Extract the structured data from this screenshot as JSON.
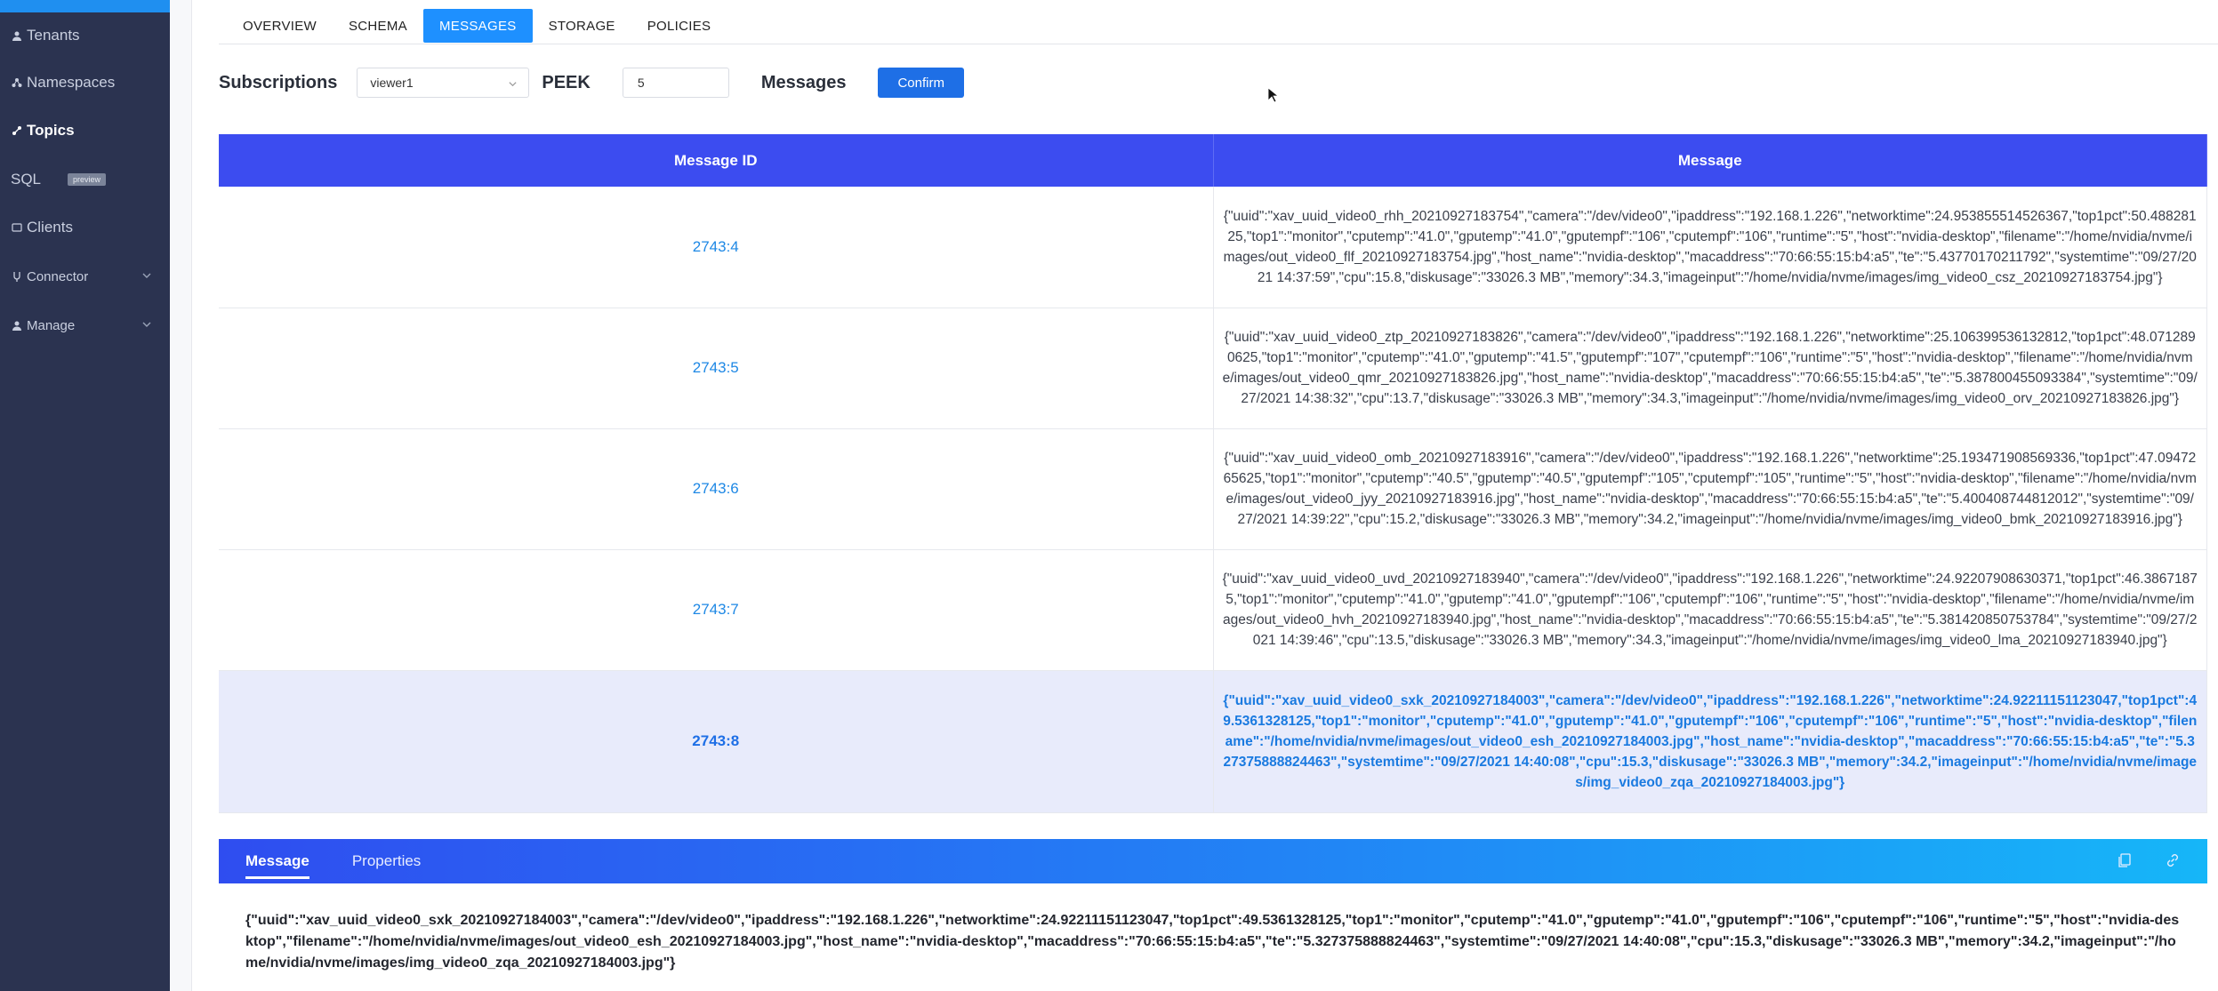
{
  "sidebar": {
    "items": [
      {
        "label": "Tenants",
        "icon": "user-icon"
      },
      {
        "label": "Namespaces",
        "icon": "namespace-icon"
      },
      {
        "label": "Topics",
        "icon": "topic-icon"
      },
      {
        "label": "SQL",
        "badge": "preview"
      },
      {
        "label": "Clients",
        "icon": "clients-icon"
      },
      {
        "label": "Connector",
        "icon": "connector-icon"
      },
      {
        "label": "Manage",
        "icon": "manage-icon"
      }
    ]
  },
  "tabs": [
    "OVERVIEW",
    "SCHEMA",
    "MESSAGES",
    "STORAGE",
    "POLICIES"
  ],
  "toolbar": {
    "subscriptions_label": "Subscriptions",
    "subscription_value": "viewer1",
    "peek_label": "PEEK",
    "peek_value": "5",
    "messages_label": "Messages",
    "confirm_label": "Confirm"
  },
  "table": {
    "headers": [
      "Message ID",
      "Message"
    ],
    "rows": [
      {
        "id": "2743:4",
        "message": "{\"uuid\":\"xav_uuid_video0_rhh_20210927183754\",\"camera\":\"/dev/video0\",\"ipaddress\":\"192.168.1.226\",\"networktime\":24.953855514526367,\"top1pct\":50.48828125,\"top1\":\"monitor\",\"cputemp\":\"41.0\",\"gputemp\":\"41.0\",\"gputempf\":\"106\",\"cputempf\":\"106\",\"runtime\":\"5\",\"host\":\"nvidia-desktop\",\"filename\":\"/home/nvidia/nvme/images/out_video0_flf_20210927183754.jpg\",\"host_name\":\"nvidia-desktop\",\"macaddress\":\"70:66:55:15:b4:a5\",\"te\":\"5.43770170211792\",\"systemtime\":\"09/27/2021 14:37:59\",\"cpu\":15.8,\"diskusage\":\"33026.3 MB\",\"memory\":34.3,\"imageinput\":\"/home/nvidia/nvme/images/img_video0_csz_20210927183754.jpg\"}"
      },
      {
        "id": "2743:5",
        "message": "{\"uuid\":\"xav_uuid_video0_ztp_20210927183826\",\"camera\":\"/dev/video0\",\"ipaddress\":\"192.168.1.226\",\"networktime\":25.106399536132812,\"top1pct\":48.0712890625,\"top1\":\"monitor\",\"cputemp\":\"41.0\",\"gputemp\":\"41.5\",\"gputempf\":\"107\",\"cputempf\":\"106\",\"runtime\":\"5\",\"host\":\"nvidia-desktop\",\"filename\":\"/home/nvidia/nvme/images/out_video0_qmr_20210927183826.jpg\",\"host_name\":\"nvidia-desktop\",\"macaddress\":\"70:66:55:15:b4:a5\",\"te\":\"5.387800455093384\",\"systemtime\":\"09/27/2021 14:38:32\",\"cpu\":13.7,\"diskusage\":\"33026.3 MB\",\"memory\":34.3,\"imageinput\":\"/home/nvidia/nvme/images/img_video0_orv_20210927183826.jpg\"}"
      },
      {
        "id": "2743:6",
        "message": "{\"uuid\":\"xav_uuid_video0_omb_20210927183916\",\"camera\":\"/dev/video0\",\"ipaddress\":\"192.168.1.226\",\"networktime\":25.193471908569336,\"top1pct\":47.0947265625,\"top1\":\"monitor\",\"cputemp\":\"40.5\",\"gputemp\":\"40.5\",\"gputempf\":\"105\",\"cputempf\":\"105\",\"runtime\":\"5\",\"host\":\"nvidia-desktop\",\"filename\":\"/home/nvidia/nvme/images/out_video0_jyy_20210927183916.jpg\",\"host_name\":\"nvidia-desktop\",\"macaddress\":\"70:66:55:15:b4:a5\",\"te\":\"5.400408744812012\",\"systemtime\":\"09/27/2021 14:39:22\",\"cpu\":15.2,\"diskusage\":\"33026.3 MB\",\"memory\":34.2,\"imageinput\":\"/home/nvidia/nvme/images/img_video0_bmk_20210927183916.jpg\"}"
      },
      {
        "id": "2743:7",
        "message": "{\"uuid\":\"xav_uuid_video0_uvd_20210927183940\",\"camera\":\"/dev/video0\",\"ipaddress\":\"192.168.1.226\",\"networktime\":24.92207908630371,\"top1pct\":46.38671875,\"top1\":\"monitor\",\"cputemp\":\"41.0\",\"gputemp\":\"41.0\",\"gputempf\":\"106\",\"cputempf\":\"106\",\"runtime\":\"5\",\"host\":\"nvidia-desktop\",\"filename\":\"/home/nvidia/nvme/images/out_video0_hvh_20210927183940.jpg\",\"host_name\":\"nvidia-desktop\",\"macaddress\":\"70:66:55:15:b4:a5\",\"te\":\"5.381420850753784\",\"systemtime\":\"09/27/2021 14:39:46\",\"cpu\":13.5,\"diskusage\":\"33026.3 MB\",\"memory\":34.3,\"imageinput\":\"/home/nvidia/nvme/images/img_video0_lma_20210927183940.jpg\"}"
      },
      {
        "id": "2743:8",
        "message": "{\"uuid\":\"xav_uuid_video0_sxk_20210927184003\",\"camera\":\"/dev/video0\",\"ipaddress\":\"192.168.1.226\",\"networktime\":24.92211151123047,\"top1pct\":49.5361328125,\"top1\":\"monitor\",\"cputemp\":\"41.0\",\"gputemp\":\"41.0\",\"gputempf\":\"106\",\"cputempf\":\"106\",\"runtime\":\"5\",\"host\":\"nvidia-desktop\",\"filename\":\"/home/nvidia/nvme/images/out_video0_esh_20210927184003.jpg\",\"host_name\":\"nvidia-desktop\",\"macaddress\":\"70:66:55:15:b4:a5\",\"te\":\"5.327375888824463\",\"systemtime\":\"09/27/2021 14:40:08\",\"cpu\":15.3,\"diskusage\":\"33026.3 MB\",\"memory\":34.2,\"imageinput\":\"/home/nvidia/nvme/images/img_video0_zqa_20210927184003.jpg\"}"
      }
    ]
  },
  "detail": {
    "tabs": [
      "Message",
      "Properties"
    ],
    "body": "{\"uuid\":\"xav_uuid_video0_sxk_20210927184003\",\"camera\":\"/dev/video0\",\"ipaddress\":\"192.168.1.226\",\"networktime\":24.92211151123047,\"top1pct\":49.5361328125,\"top1\":\"monitor\",\"cputemp\":\"41.0\",\"gputemp\":\"41.0\",\"gputempf\":\"106\",\"cputempf\":\"106\",\"runtime\":\"5\",\"host\":\"nvidia-desktop\",\"filename\":\"/home/nvidia/nvme/images/out_video0_esh_20210927184003.jpg\",\"host_name\":\"nvidia-desktop\",\"macaddress\":\"70:66:55:15:b4:a5\",\"te\":\"5.327375888824463\",\"systemtime\":\"09/27/2021 14:40:08\",\"cpu\":15.3,\"diskusage\":\"33026.3 MB\",\"memory\":34.2,\"imageinput\":\"/home/nvidia/nvme/images/img_video0_zqa_20210927184003.jpg\"}"
  },
  "colors": {
    "sidebar_bg": "#2b3350",
    "accent": "#1e90ff",
    "table_header": "#3c4cf0",
    "link": "#1e88e5",
    "selected_row": "#e8ebfb"
  }
}
